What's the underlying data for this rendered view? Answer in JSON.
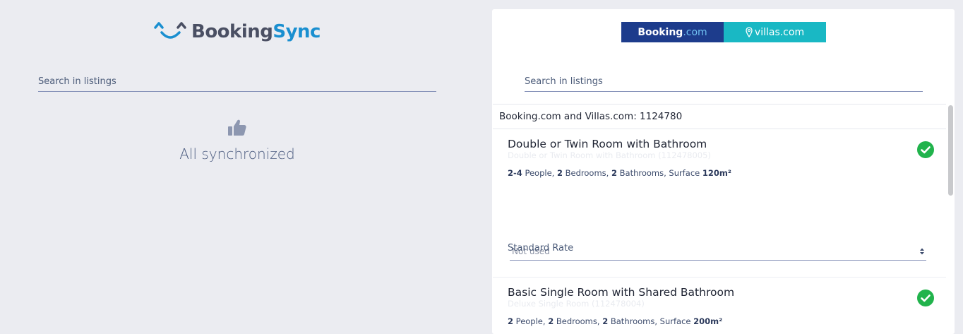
{
  "left": {
    "logo": {
      "part1": "Booking",
      "part2": "Sync"
    },
    "search": {
      "placeholder": "Search in listings",
      "value": ""
    },
    "status": {
      "icon": "thumbs-up-icon",
      "text": "All synchronized"
    }
  },
  "right": {
    "brand": {
      "booking_name": "Booking",
      "booking_suffix": ".com",
      "villas_name": "villas.com"
    },
    "search": {
      "placeholder": "Search in listings",
      "value": ""
    },
    "account": {
      "label": "Booking.com and Villas.com: 1124780"
    },
    "listings": [
      {
        "title": "Double or Twin Room with Bathroom",
        "subtitle": "Double or Twin Room with Bathroom (112478005)",
        "people": "2-4",
        "people_label": "People,",
        "bedrooms": "2",
        "bedrooms_label": "Bedrooms,",
        "bathrooms": "2",
        "bathrooms_label": "Bathrooms, Surface",
        "surface": "120m²",
        "status_icon": "check-circle-icon",
        "rate": {
          "label": "Standard Rate",
          "value": "Not used"
        }
      },
      {
        "title": "Basic Single Room with Shared Bathroom",
        "subtitle": "Deluxe Single Room (112478004)",
        "people": "2",
        "people_label": "People,",
        "bedrooms": "2",
        "bedrooms_label": "Bedrooms,",
        "bathrooms": "2",
        "bathrooms_label": "Bathrooms, Surface",
        "surface": "200m²",
        "status_icon": "check-circle-icon"
      }
    ]
  },
  "colors": {
    "background": "#ebecf1",
    "panel": "#ffffff",
    "accent_blue": "#1a8fd0",
    "booking_navy": "#1d3c8c",
    "villas_teal": "#19b8c4",
    "success_green": "#21b34c"
  }
}
